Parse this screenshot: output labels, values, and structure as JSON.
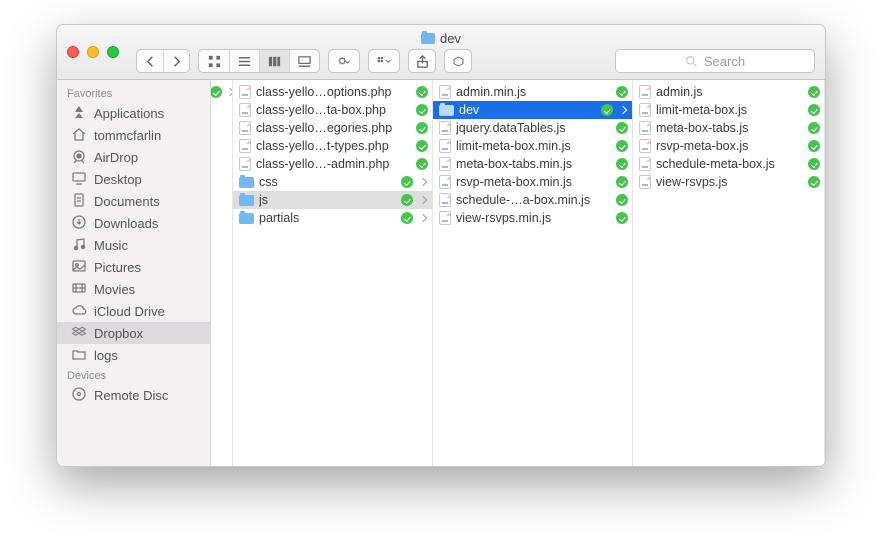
{
  "window": {
    "title": "dev"
  },
  "search": {
    "placeholder": "Search"
  },
  "sidebar": {
    "sections": [
      {
        "title": "Favorites",
        "items": [
          {
            "icon": "apps",
            "label": "Applications"
          },
          {
            "icon": "home",
            "label": "tommcfarlin"
          },
          {
            "icon": "airdrop",
            "label": "AirDrop"
          },
          {
            "icon": "desktop",
            "label": "Desktop"
          },
          {
            "icon": "docs",
            "label": "Documents"
          },
          {
            "icon": "downloads",
            "label": "Downloads"
          },
          {
            "icon": "music",
            "label": "Music"
          },
          {
            "icon": "pictures",
            "label": "Pictures"
          },
          {
            "icon": "movies",
            "label": "Movies"
          },
          {
            "icon": "cloud",
            "label": "iCloud Drive"
          },
          {
            "icon": "dropbox",
            "label": "Dropbox",
            "selected": true
          },
          {
            "icon": "folder",
            "label": "logs"
          }
        ]
      },
      {
        "title": "Devices",
        "items": [
          {
            "icon": "disc",
            "label": "Remote Disc"
          }
        ]
      }
    ]
  },
  "columns": [
    [
      {
        "type": "folder",
        "name": "",
        "synced": true,
        "hasChildren": true
      }
    ],
    [
      {
        "type": "file",
        "ext": "php",
        "name": "class-yello…options.php",
        "synced": true
      },
      {
        "type": "file",
        "ext": "php",
        "name": "class-yello…ta-box.php",
        "synced": true
      },
      {
        "type": "file",
        "ext": "php",
        "name": "class-yello…egories.php",
        "synced": true
      },
      {
        "type": "file",
        "ext": "php",
        "name": "class-yello…t-types.php",
        "synced": true
      },
      {
        "type": "file",
        "ext": "php",
        "name": "class-yello…-admin.php",
        "synced": true
      },
      {
        "type": "folder",
        "name": "css",
        "synced": true,
        "hasChildren": true
      },
      {
        "type": "folder",
        "name": "js",
        "synced": true,
        "hasChildren": true,
        "selected": true
      },
      {
        "type": "folder",
        "name": "partials",
        "synced": true,
        "hasChildren": true
      }
    ],
    [
      {
        "type": "file",
        "ext": "js",
        "name": "admin.min.js",
        "synced": true
      },
      {
        "type": "folder",
        "name": "dev",
        "synced": true,
        "hasChildren": true,
        "selected": true,
        "blue": true
      },
      {
        "type": "file",
        "ext": "js",
        "name": "jquery.dataTables.js",
        "synced": true
      },
      {
        "type": "file",
        "ext": "js",
        "name": "limit-meta-box.min.js",
        "synced": true
      },
      {
        "type": "file",
        "ext": "js",
        "name": "meta-box-tabs.min.js",
        "synced": true
      },
      {
        "type": "file",
        "ext": "js",
        "name": "rsvp-meta-box.min.js",
        "synced": true
      },
      {
        "type": "file",
        "ext": "js",
        "name": "schedule-…a-box.min.js",
        "synced": true
      },
      {
        "type": "file",
        "ext": "js",
        "name": "view-rsvps.min.js",
        "synced": true
      }
    ],
    [
      {
        "type": "file",
        "ext": "js",
        "name": "admin.js",
        "synced": true
      },
      {
        "type": "file",
        "ext": "js",
        "name": "limit-meta-box.js",
        "synced": true
      },
      {
        "type": "file",
        "ext": "js",
        "name": "meta-box-tabs.js",
        "synced": true
      },
      {
        "type": "file",
        "ext": "js",
        "name": "rsvp-meta-box.js",
        "synced": true
      },
      {
        "type": "file",
        "ext": "js",
        "name": "schedule-meta-box.js",
        "synced": true
      },
      {
        "type": "file",
        "ext": "js",
        "name": "view-rsvps.js",
        "synced": true
      }
    ]
  ]
}
